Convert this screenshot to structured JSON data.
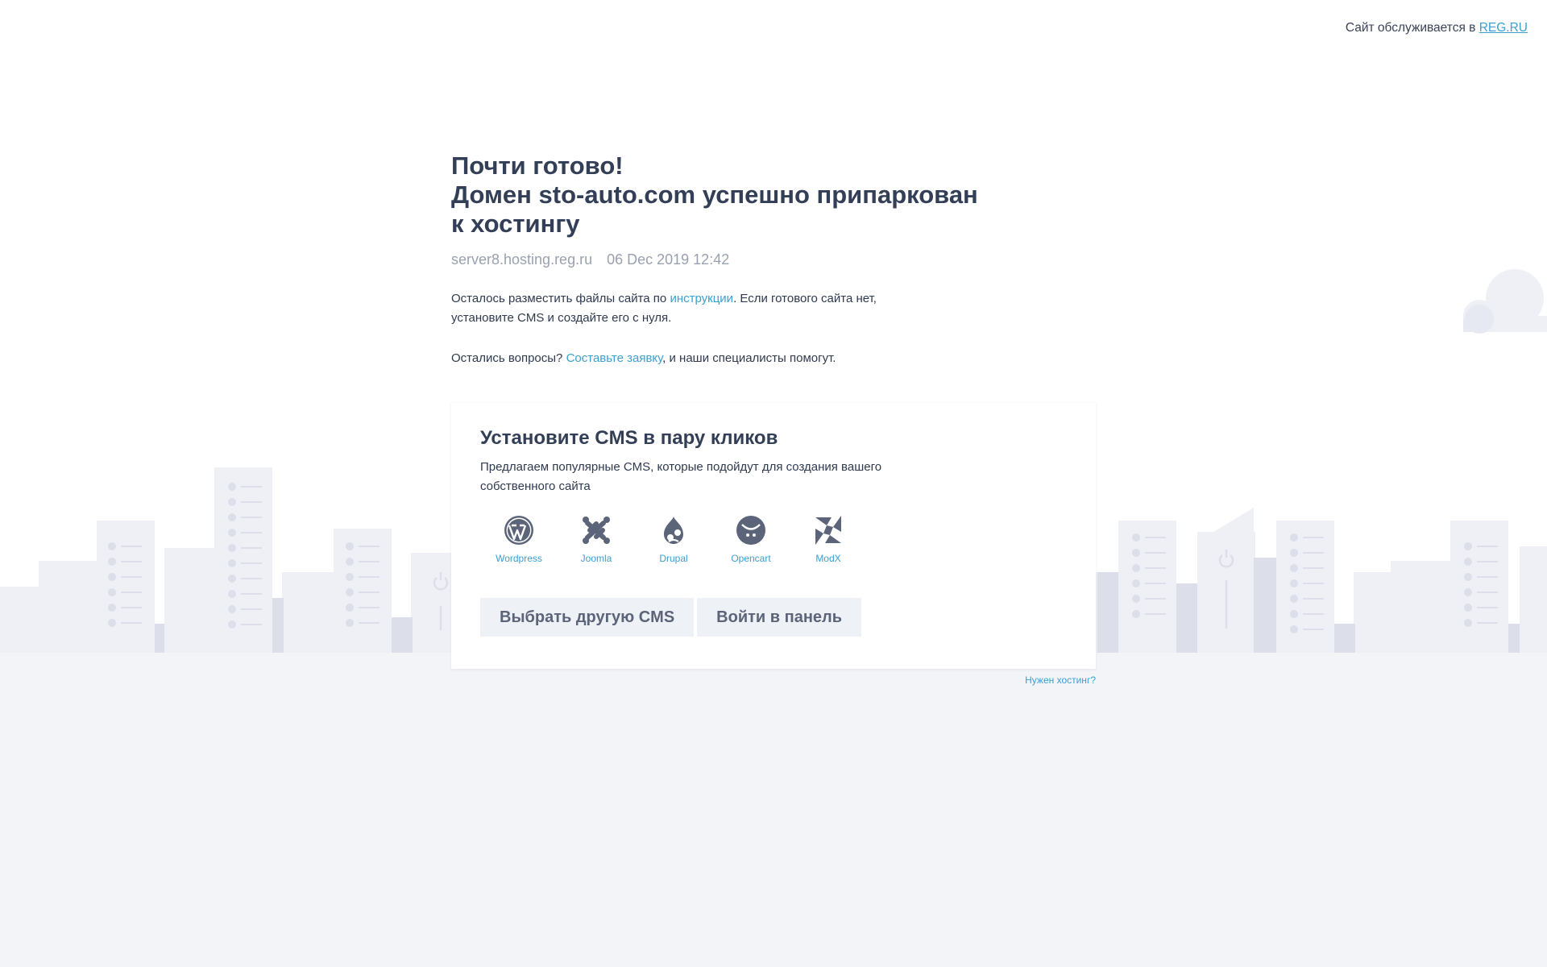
{
  "topbar": {
    "served_text": "Сайт обслуживается в",
    "registrar_link": "REG.RU"
  },
  "main": {
    "title_line1": "Почти готово!",
    "title_line2": "Домен sto-auto.com успешно припаркован",
    "title_line3": "к хостингу",
    "server": "server8.hosting.reg.ru",
    "datetime": "06 Dec 2019 12:42",
    "para1_before": "Осталось разместить файлы сайта по ",
    "para1_link": "инструкции",
    "para1_after": ". Если готового сайта нет, установите CMS и создайте его с нуля.",
    "para2_before": "Остались вопросы? ",
    "para2_link": "Составьте заявку",
    "para2_after": ", и наши специалисты помогут."
  },
  "card": {
    "title": "Установите CMS в пару кликов",
    "description": "Предлагаем популярные CMS, которые подойдут для создания вашего собственного сайта",
    "cms": [
      {
        "label": "Wordpress",
        "icon": "wordpress-icon"
      },
      {
        "label": "Joomla",
        "icon": "joomla-icon"
      },
      {
        "label": "Drupal",
        "icon": "drupal-icon"
      },
      {
        "label": "Opencart",
        "icon": "opencart-icon"
      },
      {
        "label": "ModX",
        "icon": "modx-icon"
      }
    ],
    "btn_other_cms": "Выбрать другую CMS",
    "btn_panel": "Войти в панель"
  },
  "footer": {
    "hosting_link": "Нужен хостинг?"
  },
  "colors": {
    "accent": "#3b9fd1",
    "heading": "#333e57",
    "muted": "#9aa1ae",
    "ground": "#f2f4f8",
    "icon": "#5b6478"
  }
}
